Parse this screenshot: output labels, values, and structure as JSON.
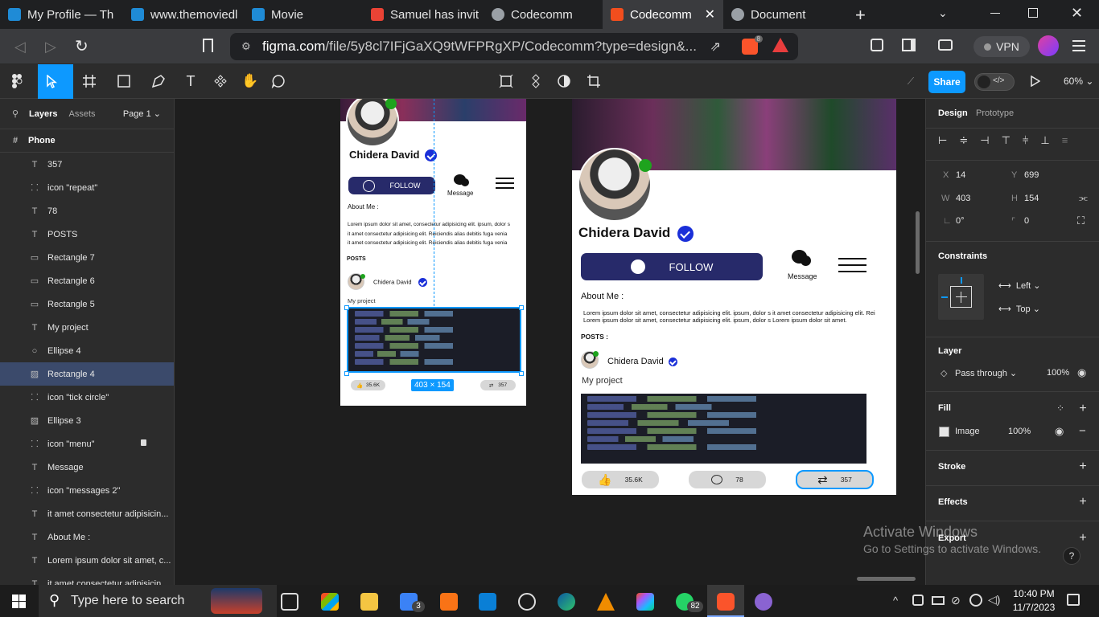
{
  "browser": {
    "tabs": [
      {
        "title": "My Profile — Th",
        "color": "#1f8bd6"
      },
      {
        "title": "www.themoviedl",
        "color": "#1f8bd6"
      },
      {
        "title": "Movie",
        "color": "#1f8bd6"
      },
      {
        "title": "Samuel has invit",
        "color": "#ea4335"
      },
      {
        "title": "Codecomm",
        "color": "#9aa0a6"
      },
      {
        "title": "Codecomm",
        "color": "#f24e1e"
      },
      {
        "title": "Document",
        "color": "#9aa0a6"
      }
    ],
    "url_host": "figma.com",
    "url_path": "/file/5y8cl7IFjGaXQ9tWFPRgXP/Codecomm?type=design&...",
    "shields_count": "8",
    "vpn_label": "VPN"
  },
  "figma": {
    "share_label": "Share",
    "zoom": "60%",
    "left_tabs": {
      "layers": "Layers",
      "assets": "Assets",
      "page": "Page 1"
    },
    "frame_name": "Phone",
    "layers": [
      {
        "icon": "T",
        "name": "357"
      },
      {
        "icon": "⸬",
        "name": "icon \"repeat\""
      },
      {
        "icon": "T",
        "name": "78"
      },
      {
        "icon": "T",
        "name": "POSTS"
      },
      {
        "icon": "▭",
        "name": "Rectangle 7"
      },
      {
        "icon": "▭",
        "name": "Rectangle 6"
      },
      {
        "icon": "▭",
        "name": "Rectangle 5"
      },
      {
        "icon": "T",
        "name": "My project"
      },
      {
        "icon": "○",
        "name": "Ellipse 4"
      },
      {
        "icon": "▨",
        "name": "Rectangle 4"
      },
      {
        "icon": "⸬",
        "name": "icon \"tick circle\""
      },
      {
        "icon": "▨",
        "name": "Ellipse 3"
      },
      {
        "icon": "⸬",
        "name": "icon \"menu\""
      },
      {
        "icon": "T",
        "name": "Message"
      },
      {
        "icon": "⸬",
        "name": "icon \"messages 2\""
      },
      {
        "icon": "T",
        "name": "it amet consectetur adipisicin..."
      },
      {
        "icon": "T",
        "name": "About Me :"
      },
      {
        "icon": "T",
        "name": "Lorem ipsum dolor sit amet, c..."
      },
      {
        "icon": "T",
        "name": "it amet consectetur adipisicin..."
      }
    ],
    "selected_layer": "Rectangle 4",
    "right_tabs": {
      "design": "Design",
      "prototype": "Prototype"
    },
    "props": {
      "x": "14",
      "y": "699",
      "w": "403",
      "h": "154",
      "rotation": "0°",
      "radius": "0"
    },
    "labels": {
      "x": "X",
      "y": "Y",
      "w": "W",
      "h": "H"
    },
    "constraints": {
      "title": "Constraints",
      "horizontal": "Left",
      "vertical": "Top"
    },
    "layer_section": {
      "title": "Layer",
      "blend": "Pass through",
      "opacity": "100%"
    },
    "fill": {
      "title": "Fill",
      "type": "Image",
      "opacity": "100%"
    },
    "sections": {
      "stroke": "Stroke",
      "effects": "Effects",
      "export": "Export"
    },
    "size_badge": "403 × 154"
  },
  "profile": {
    "name": "Chidera David",
    "follow": "FOLLOW",
    "message": "Message",
    "about": "About Me :",
    "lorem1_small": "Lorem ipsum dolor sit amet, consectetur adipisicing elit. ipsum, dolor s",
    "lorem2_small": "it amet consectetur adipisicing elit. Reiciendis alias debitis fuga venia",
    "lorem3_small": "it amet consectetur adipisicing elit. Reiciendis alias debitis fuga venia",
    "lorem1_large": "Lorem ipsum dolor sit amet, consectetur adipisicing elit. ipsum, dolor s it amet consectetur adipisicing elit. Rei",
    "lorem2_large": "Lorem ipsum dolor sit amet, consectetur adipisicing elit. ipsum, dolor s  Lorem ipsum dolor sit amet.",
    "posts": "POSTS",
    "posts_large": "POSTS :",
    "project": "My project",
    "likes": "35.6K",
    "comments": "78",
    "reposts": "357",
    "accent": "#272a6a",
    "online": "#1ea31e"
  },
  "windows": {
    "activate_title": "Activate Windows",
    "activate_sub": "Go to Settings to activate Windows.",
    "search_placeholder": "Type here to search",
    "time": "10:40 PM",
    "date": "11/7/2023",
    "mail_badge": "3",
    "whatsapp_badge": "82"
  }
}
